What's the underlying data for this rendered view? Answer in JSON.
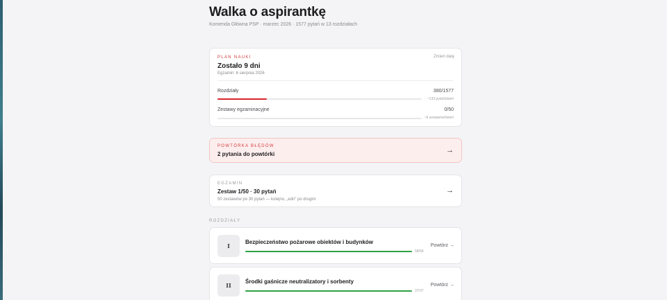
{
  "header": {
    "title": "Walka o aspirantkę",
    "subtitle": "Komenda Główna PSP · marzec 2026 · 1577 pytań w 13 rozdziałach"
  },
  "plan": {
    "label": "PLAN NAUKI",
    "change_label": "Zmień datę",
    "remaining": "Zostało 9 dni",
    "exam_date": "Egzamin: 6 sierpnia 2026",
    "chapters": {
      "label": "Rozdziały",
      "value": "380/1577",
      "note": "~133 pytań/dzień",
      "progress": 0.241
    },
    "exam_sets": {
      "label": "Zestawy egzaminacyjne",
      "value": "0/50",
      "note": "~6 zestawów/dzień",
      "progress": 0
    }
  },
  "review": {
    "label": "POWTÓRKA BŁĘDÓW",
    "text": "2 pytania do powtórki",
    "arrow": "→"
  },
  "exam": {
    "label": "EGZAMIN",
    "text": "Zestaw 1/50 · 30 pytań",
    "desc": "50 zestawów po 30 pytań — kolejno, „edn” po drugim",
    "arrow": "→"
  },
  "section_label": "ROZDZIAŁY",
  "chapters": [
    {
      "num": "I",
      "name": "Bezpieczeństwo pożarowe obiektów i budynków",
      "count": "58/58",
      "progress": 1.0,
      "repeat": "Powtórz →"
    },
    {
      "num": "II",
      "name": "Środki gaśnicze neutralizatory i sorbenty",
      "count": "37/37",
      "progress": 1.0,
      "repeat": "Powtórz →"
    }
  ],
  "colors": {
    "accent_red": "#d8232a",
    "progress_green": "#2ea043",
    "review_bg": "#fdeeee"
  }
}
